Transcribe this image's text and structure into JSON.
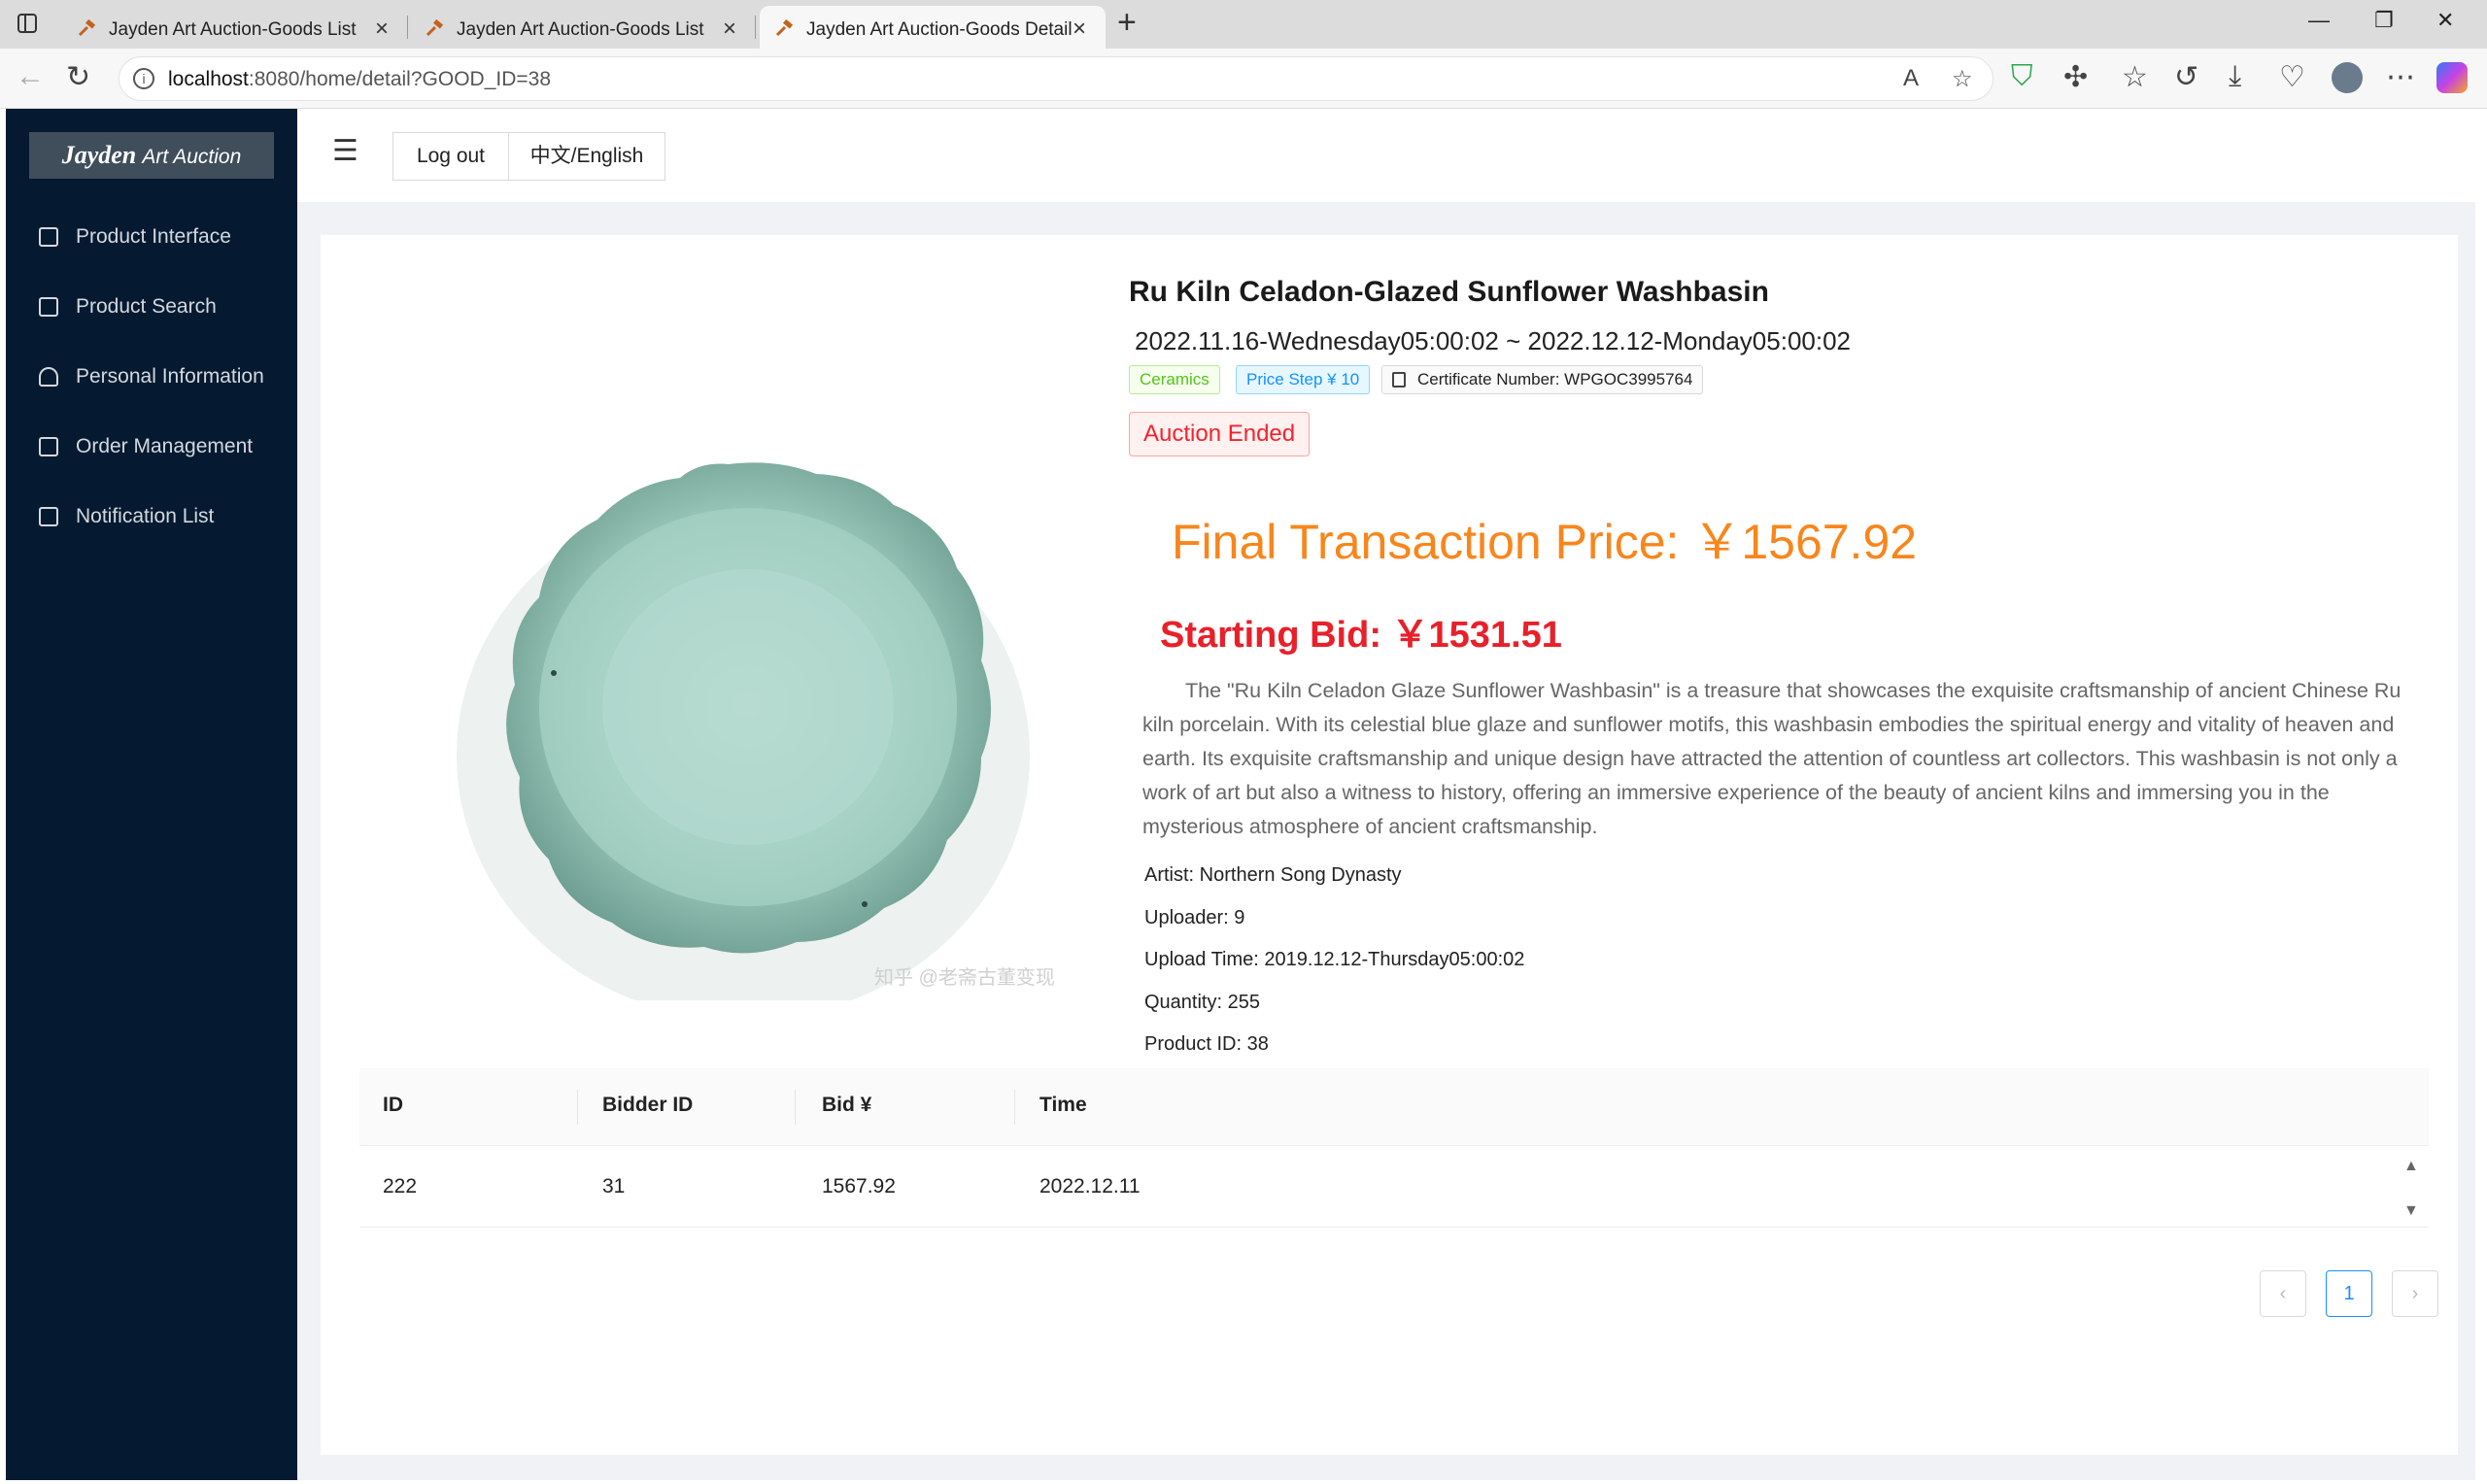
{
  "browser": {
    "tabs": [
      {
        "title": "Jayden Art Auction-Goods List"
      },
      {
        "title": "Jayden Art Auction-Goods List"
      },
      {
        "title": "Jayden Art Auction-Goods Detail"
      }
    ],
    "url_host": "localhost",
    "url_path": ":8080/home/detail?GOOD_ID=38"
  },
  "sidebar": {
    "logo_brand": "Jayden",
    "logo_rest": "Art Auction",
    "items": [
      {
        "label": "Product Interface",
        "icon": "shopping-bag-icon"
      },
      {
        "label": "Product Search",
        "icon": "search-doc-icon"
      },
      {
        "label": "Personal Information",
        "icon": "user-icon"
      },
      {
        "label": "Order Management",
        "icon": "order-doc-icon"
      },
      {
        "label": "Notification List",
        "icon": "notification-doc-icon"
      }
    ]
  },
  "header": {
    "logout_label": "Log out",
    "lang_label": "中文/English"
  },
  "product": {
    "title": "Ru Kiln Celadon-Glazed Sunflower Washbasin",
    "date_range": "2022.11.16-Wednesday05:00:02 ~ 2022.12.12-Monday05:00:02",
    "category_tag": "Ceramics",
    "price_step_tag": "Price Step ¥ 10",
    "certificate_tag": "Certificate Number: WPGOC3995764",
    "status": "Auction Ended",
    "final_price": "Final Transaction Price: ￥1567.92",
    "starting_bid": "Starting Bid: ￥1531.51",
    "description": "The \"Ru Kiln Celadon Glaze Sunflower Washbasin\" is a treasure that showcases the exquisite craftsmanship of ancient Chinese Ru kiln porcelain. With its celestial blue glaze and sunflower motifs, this washbasin embodies the spiritual energy and vitality of heaven and earth. Its exquisite craftsmanship and unique design have attracted the attention of countless art collectors. This washbasin is not only a work of art but also a witness to history, offering an immersive experience of the beauty of ancient kilns and immersing you in the mysterious atmosphere of ancient craftsmanship.",
    "artist": "Artist: Northern Song Dynasty",
    "uploader": "Uploader: 9",
    "upload_time": "Upload Time: 2019.12.12-Thursday05:00:02",
    "quantity": "Quantity: 255",
    "product_id": "Product ID: 38",
    "image_watermark": "知乎 @老斋古董变现"
  },
  "bids_table": {
    "columns": [
      "ID",
      "Bidder ID",
      "Bid ¥",
      "Time"
    ],
    "rows": [
      [
        "222",
        "31",
        "1567.92",
        "2022.12.11"
      ]
    ]
  },
  "pagination": {
    "current_page": "1",
    "prev": "‹",
    "next": "›"
  },
  "colors": {
    "sidebar_bg": "#051a31",
    "final_price": "#f7861c",
    "starting_bid": "#e8202a",
    "status_red": "#f5222d"
  }
}
